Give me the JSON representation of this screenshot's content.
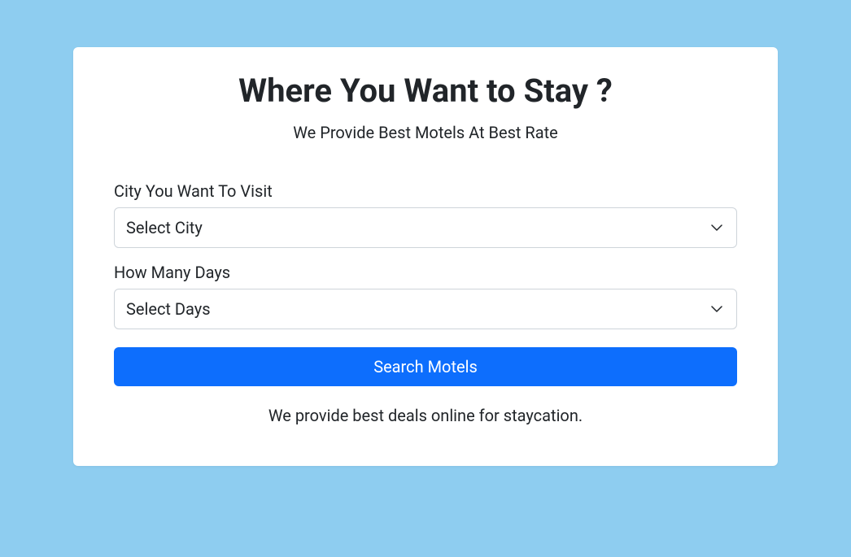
{
  "header": {
    "title": "Where You Want to Stay ?",
    "subtitle": "We Provide Best Motels At Best Rate"
  },
  "form": {
    "city": {
      "label": "City You Want To Visit",
      "placeholder": "Select City"
    },
    "days": {
      "label": "How Many Days",
      "placeholder": "Select Days"
    },
    "submit_label": "Search Motels"
  },
  "footer": {
    "text": "We provide best deals online for staycation."
  }
}
